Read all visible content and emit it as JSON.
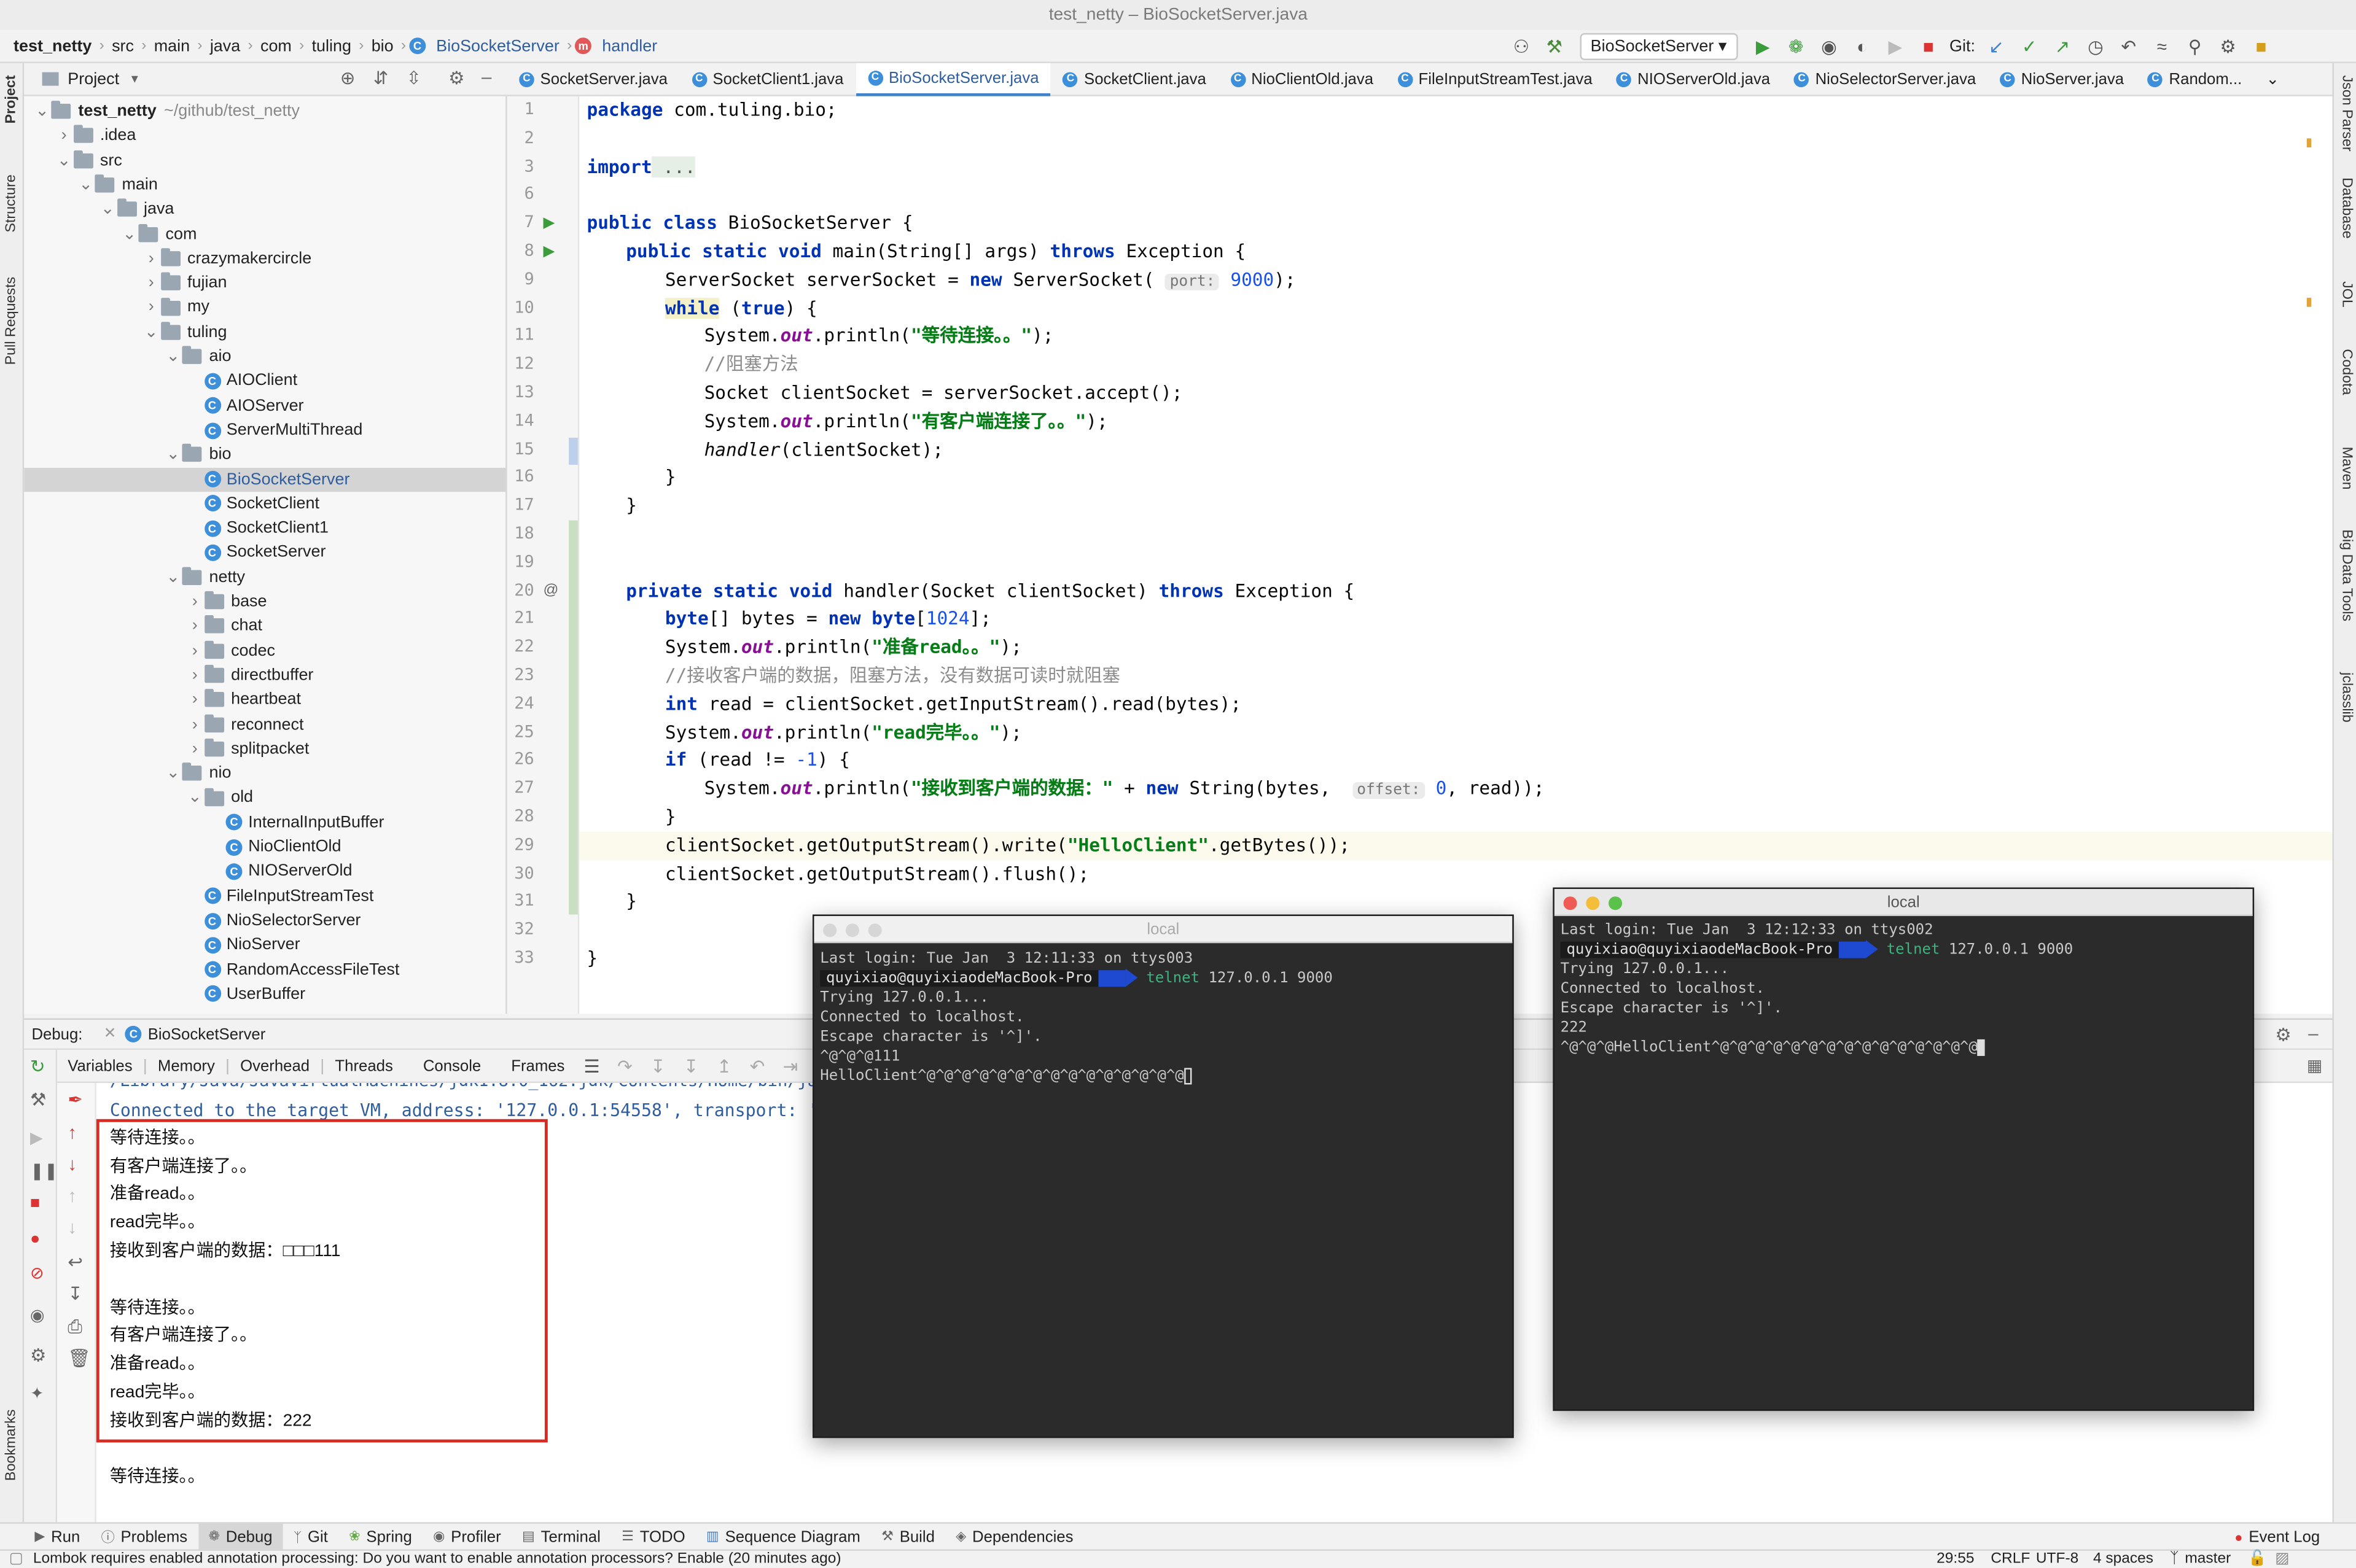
{
  "window": {
    "title": "test_netty – BioSocketServer.java"
  },
  "breadcrumb": [
    "test_netty",
    "src",
    "main",
    "java",
    "com",
    "tuling",
    "bio",
    "BioSocketServer",
    "handler"
  ],
  "toolbar": {
    "run_config": "BioSocketServer",
    "git_label": "Git:"
  },
  "project_panel": {
    "title": "Project",
    "tree": [
      {
        "label": "test_netty",
        "suffix": "~/github/test_netty",
        "depth": 0,
        "kind": "folder",
        "open": true
      },
      {
        "label": ".idea",
        "depth": 1,
        "kind": "folder",
        "open": false
      },
      {
        "label": "src",
        "depth": 1,
        "kind": "folder",
        "open": true
      },
      {
        "label": "main",
        "depth": 2,
        "kind": "folder",
        "open": true
      },
      {
        "label": "java",
        "depth": 3,
        "kind": "folder",
        "open": true
      },
      {
        "label": "com",
        "depth": 4,
        "kind": "folder",
        "open": true
      },
      {
        "label": "crazymakercircle",
        "depth": 5,
        "kind": "folder",
        "open": false
      },
      {
        "label": "fujian",
        "depth": 5,
        "kind": "folder",
        "open": false
      },
      {
        "label": "my",
        "depth": 5,
        "kind": "folder",
        "open": false
      },
      {
        "label": "tuling",
        "depth": 5,
        "kind": "folder",
        "open": true
      },
      {
        "label": "aio",
        "depth": 6,
        "kind": "folder",
        "open": true
      },
      {
        "label": "AIOClient",
        "depth": 7,
        "kind": "class"
      },
      {
        "label": "AIOServer",
        "depth": 7,
        "kind": "class"
      },
      {
        "label": "ServerMultiThread",
        "depth": 7,
        "kind": "class"
      },
      {
        "label": "bio",
        "depth": 6,
        "kind": "folder",
        "open": true
      },
      {
        "label": "BioSocketServer",
        "depth": 7,
        "kind": "class",
        "selected": true
      },
      {
        "label": "SocketClient",
        "depth": 7,
        "kind": "class"
      },
      {
        "label": "SocketClient1",
        "depth": 7,
        "kind": "class"
      },
      {
        "label": "SocketServer",
        "depth": 7,
        "kind": "class"
      },
      {
        "label": "netty",
        "depth": 6,
        "kind": "folder",
        "open": true
      },
      {
        "label": "base",
        "depth": 7,
        "kind": "folder",
        "open": false
      },
      {
        "label": "chat",
        "depth": 7,
        "kind": "folder",
        "open": false
      },
      {
        "label": "codec",
        "depth": 7,
        "kind": "folder",
        "open": false
      },
      {
        "label": "directbuffer",
        "depth": 7,
        "kind": "folder",
        "open": false
      },
      {
        "label": "heartbeat",
        "depth": 7,
        "kind": "folder",
        "open": false
      },
      {
        "label": "reconnect",
        "depth": 7,
        "kind": "folder",
        "open": false
      },
      {
        "label": "splitpacket",
        "depth": 7,
        "kind": "folder",
        "open": false
      },
      {
        "label": "nio",
        "depth": 6,
        "kind": "folder",
        "open": true
      },
      {
        "label": "old",
        "depth": 7,
        "kind": "folder",
        "open": true
      },
      {
        "label": "InternalInputBuffer",
        "depth": 8,
        "kind": "class"
      },
      {
        "label": "NioClientOld",
        "depth": 8,
        "kind": "class"
      },
      {
        "label": "NIOServerOld",
        "depth": 8,
        "kind": "class"
      },
      {
        "label": "FileInputStreamTest",
        "depth": 7,
        "kind": "class"
      },
      {
        "label": "NioSelectorServer",
        "depth": 7,
        "kind": "class"
      },
      {
        "label": "NioServer",
        "depth": 7,
        "kind": "class"
      },
      {
        "label": "RandomAccessFileTest",
        "depth": 7,
        "kind": "class"
      },
      {
        "label": "UserBuffer",
        "depth": 7,
        "kind": "class"
      }
    ]
  },
  "editor_tabs": [
    "SocketServer.java",
    "SocketClient1.java",
    "BioSocketServer.java",
    "SocketClient.java",
    "NioClientOld.java",
    "FileInputStreamTest.java",
    "NIOServerOld.java",
    "NioSelectorServer.java",
    "NioServer.java",
    "Random..."
  ],
  "active_tab": "BioSocketServer.java",
  "inspections": {
    "warnings": "2",
    "weak_warnings": "1"
  },
  "code": {
    "line_numbers": [
      "1",
      "2",
      "3",
      "6",
      "7",
      "8",
      "9",
      "10",
      "11",
      "12",
      "13",
      "14",
      "15",
      "16",
      "17",
      "18",
      "19",
      "20",
      "21",
      "22",
      "23",
      "24",
      "25",
      "26",
      "27",
      "28",
      "29",
      "30",
      "31",
      "32",
      "33"
    ],
    "l1_kw": "package",
    "l1_text": " com.tuling.bio;",
    "l3_kw": "import",
    "l3_fold": " ...",
    "l7_kw": "public class",
    "l7_text": " BioSocketServer {",
    "l8_kw1": "public static void",
    "l8_text1": " main(String[] args) ",
    "l8_kw2": "throws",
    "l8_text2": " Exception {",
    "l9_text1": "ServerSocket serverSocket = ",
    "l9_kw": "new",
    "l9_text2": " ServerSocket(",
    "l9_hint": "port:",
    "l9_num": "9000",
    "l9_text3": ");",
    "l10_kw1": "while",
    "l10_text1": " (",
    "l10_kw2": "true",
    "l10_text2": ") {",
    "out_prefix": "System.",
    "out_field": "out",
    "out_call": ".println(",
    "l11_str": "\"等待连接。。\"",
    "close_stmt": ");",
    "l12_cm": "//阻塞方法",
    "l13_text": "Socket clientSocket = serverSocket.accept();",
    "l14_str": "\"有客户端连接了。。\"",
    "l15_it": "handler",
    "l15_text": "(clientSocket);",
    "brace_close": "}",
    "l20_kw1": "private static void",
    "l20_text1": " handler(Socket clientSocket) ",
    "l20_kw2": "throws",
    "l20_text2": " Exception {",
    "l21_kw1": "byte",
    "l21_text1": "[] bytes = ",
    "l21_kw2": "new byte",
    "l21_text2": "[",
    "l21_num": "1024",
    "l21_text3": "];",
    "l22_str": "\"准备read。。\"",
    "l23_cm": "//接收客户端的数据，阻塞方法，没有数据可读时就阻塞",
    "l24_kw": "int",
    "l24_text": " read = clientSocket.getInputStream().read(bytes);",
    "l25_str": "\"read完毕。。\"",
    "l26_kw": "if",
    "l26_text1": " (read != ",
    "l26_num": "-1",
    "l26_text2": ") {",
    "l27_str": "\"接收到客户端的数据：\"",
    "l27_text1": " + ",
    "l27_kw": "new",
    "l27_text2": " String(bytes, ",
    "l27_hint": "offset:",
    "l27_num": "0",
    "l27_text3": ", read));",
    "l29_text1": "clientSocket.getOutputStream().write(",
    "l29_str": "\"HelloClient\"",
    "l29_text2": ".getBytes());",
    "l30_text": "clientSocket.getOutputStream().flush();"
  },
  "debug": {
    "label": "Debug:",
    "session": "BioSocketServer",
    "tabs": [
      "Variables",
      "Memory",
      "Overhead",
      "Threads",
      "Console",
      "Frames"
    ],
    "path_line": "/Library/Java/JavaVirtualMachines/jdk1.8.0_162.jdk/Contents/Home/bin/java ...",
    "console_lines": [
      "Connected to the target VM, address: '127.0.0.1:54558', transport: 'socket'",
      "等待连接。。",
      "有客户端连接了。。",
      "准备read。。",
      "read完毕。。",
      "接收到客户端的数据：□□□111",
      "",
      "等待连接。。",
      "有客户端连接了。。",
      "准备read。。",
      "read完毕。。",
      "接收到客户端的数据：222",
      "",
      "等待连接。。"
    ]
  },
  "terminal_left": {
    "title": "local",
    "last_login": "Last login: Tue Jan  3 12:11:33 on ttys003",
    "prompt_user": "quyixiao@quyixiaodeMacBook-Pro",
    "cmd": "telnet",
    "args": " 127.0.0.1 9000",
    "lines": [
      "Trying 127.0.0.1...",
      "Connected to localhost.",
      "Escape character is '^]'.",
      "^@^@^@111"
    ],
    "last_line": "HelloClient^@^@^@^@^@^@^@^@^@^@^@^@^@^@^@"
  },
  "terminal_right": {
    "title": "local",
    "last_login": "Last login: Tue Jan  3 12:12:33 on ttys002",
    "prompt_user": "quyixiao@quyixiaodeMacBook-Pro",
    "cmd": "telnet",
    "args": " 127.0.0.1 9000",
    "lines": [
      "Trying 127.0.0.1...",
      "Connected to localhost.",
      "Escape character is '^]'.",
      "222"
    ],
    "last_line": "^@^@^@HelloClient^@^@^@^@^@^@^@^@^@^@^@^@^@^@^@"
  },
  "bottom_tools": [
    "Run",
    "Problems",
    "Debug",
    "Git",
    "Spring",
    "Profiler",
    "Terminal",
    "TODO",
    "Sequence Diagram",
    "Build",
    "Dependencies"
  ],
  "event_log": "Event Log",
  "status": {
    "message": "Lombok requires enabled annotation processing: Do you want to enable annotation processors? Enable (20 minutes ago)",
    "position": "29:55",
    "line_sep": "CRLF",
    "encoding": "UTF-8",
    "indent": "4 spaces",
    "branch": "master"
  },
  "left_strip": [
    "Project",
    "Structure",
    "Pull Requests",
    "Bookmarks"
  ],
  "right_strip": [
    "Json Parser",
    "Database",
    "JOL",
    "Codota",
    "Maven",
    "Big Data Tools",
    "jclasslib"
  ],
  "colors": {
    "accent": "#4083c9",
    "keyword": "#0033b3",
    "string": "#067d17",
    "highlight_box": "#d92b22",
    "terminal_bg": "#2b2b2b",
    "prompt_arrow": "#1e4ad1"
  }
}
